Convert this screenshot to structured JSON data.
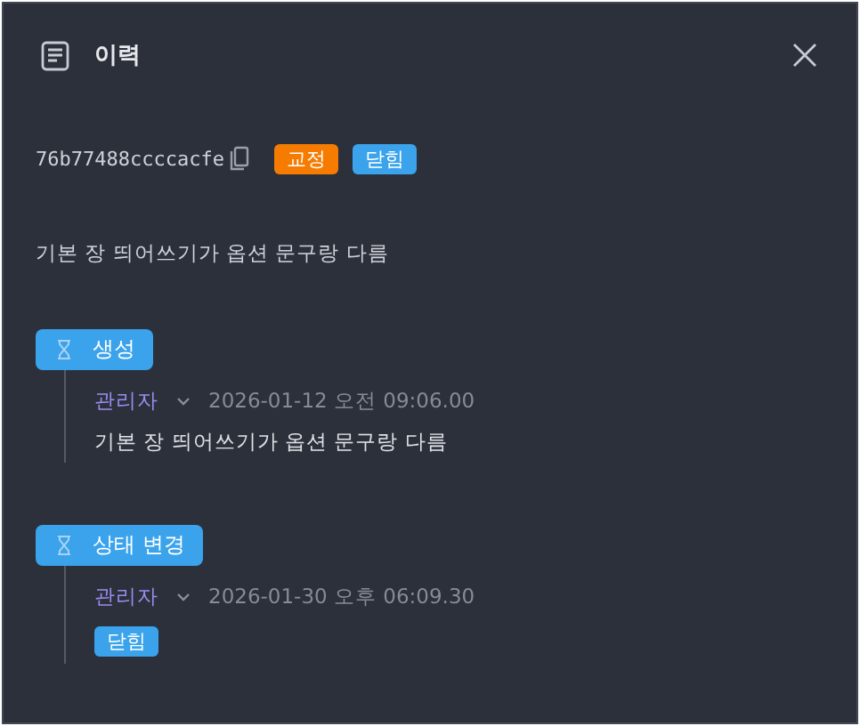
{
  "window": {
    "title": "이력"
  },
  "record": {
    "id": "76b77488ccccacfe",
    "tags": [
      {
        "label": "교정",
        "color": "#f57c00"
      },
      {
        "label": "닫힘",
        "color": "#3aa3ec"
      }
    ],
    "description": "기본 장 띄어쓰기가 옵션 문구랑 다름"
  },
  "events": [
    {
      "title": "생성",
      "user": "관리자",
      "time": "2026-01-12 오전 09:06.00",
      "kind": "text",
      "content": "기본 장 띄어쓰기가 옵션 문구랑 다름"
    },
    {
      "title": "상태 변경",
      "user": "관리자",
      "time": "2026-01-30 오후 06:09.30",
      "kind": "tag",
      "content": "닫힘",
      "color": "#3aa3ec"
    }
  ]
}
